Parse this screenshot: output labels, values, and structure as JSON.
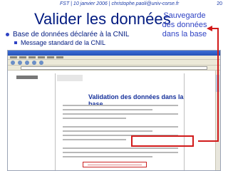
{
  "header": {
    "left": "FST | 10 janvier 2006 | christophe.paoli@univ-corse.fr",
    "page": "20"
  },
  "slide": {
    "title": "Valider les données",
    "callout_line1": "Sauvegarde",
    "callout_line2": "des données",
    "callout_line3": "dans la base",
    "bullet1": "Base de données déclarée à la CNIL",
    "bullet2": "Message standard de la CNIL"
  },
  "screenshot": {
    "heading": "Validation des données dans la base"
  },
  "colors": {
    "accent": "#2f43c4",
    "title": "#001a80",
    "highlight": "#d11a1a"
  }
}
